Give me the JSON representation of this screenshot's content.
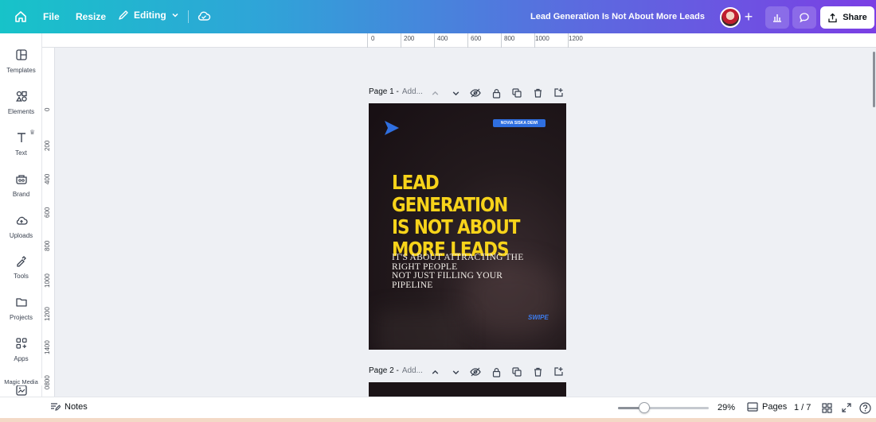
{
  "topbar": {
    "home_icon": "home-icon",
    "file_label": "File",
    "resize_label": "Resize",
    "editing_label": "Editing",
    "doc_title": "Lead Generation Is Not About More Leads",
    "share_label": "Share"
  },
  "sidebar": {
    "items": [
      {
        "label": "Templates",
        "icon": "templates-icon"
      },
      {
        "label": "Elements",
        "icon": "elements-icon"
      },
      {
        "label": "Text",
        "icon": "text-icon"
      },
      {
        "label": "Brand",
        "icon": "brand-icon"
      },
      {
        "label": "Uploads",
        "icon": "uploads-icon"
      },
      {
        "label": "Tools",
        "icon": "tools-icon"
      },
      {
        "label": "Projects",
        "icon": "projects-icon"
      },
      {
        "label": "Apps",
        "icon": "apps-icon"
      }
    ],
    "magic_media_label": "Magic Media"
  },
  "ruler_top": [
    "0",
    "200",
    "400",
    "600",
    "800",
    "1000",
    "1200"
  ],
  "ruler_left": [
    "0",
    "200",
    "400",
    "600",
    "800",
    "1000",
    "1200",
    "1400",
    "0800"
  ],
  "pages": [
    {
      "label": "Page 1 -",
      "placeholder": "Add..."
    },
    {
      "label": "Page 2 -",
      "placeholder": "Add..."
    }
  ],
  "design": {
    "author": "NOVIA SISKA DEWI",
    "headline_lines": [
      "LEAD GENERATION",
      "IS NOT ABOUT",
      "MORE LEADS"
    ],
    "sub_lines": [
      "IT'S ABOUT ATTRACTING THE",
      "RIGHT PEOPLE",
      "NOT JUST FILLING YOUR",
      "PIPELINE"
    ],
    "swipe": "SWIPE",
    "colors": {
      "headline": "#f7d31a",
      "accent": "#2f6fe0",
      "background": "#1c1417"
    }
  },
  "bottombar": {
    "notes_label": "Notes",
    "zoom_value": "29%",
    "zoom_fraction": 0.29,
    "pages_label": "Pages",
    "page_count": "1 / 7"
  }
}
